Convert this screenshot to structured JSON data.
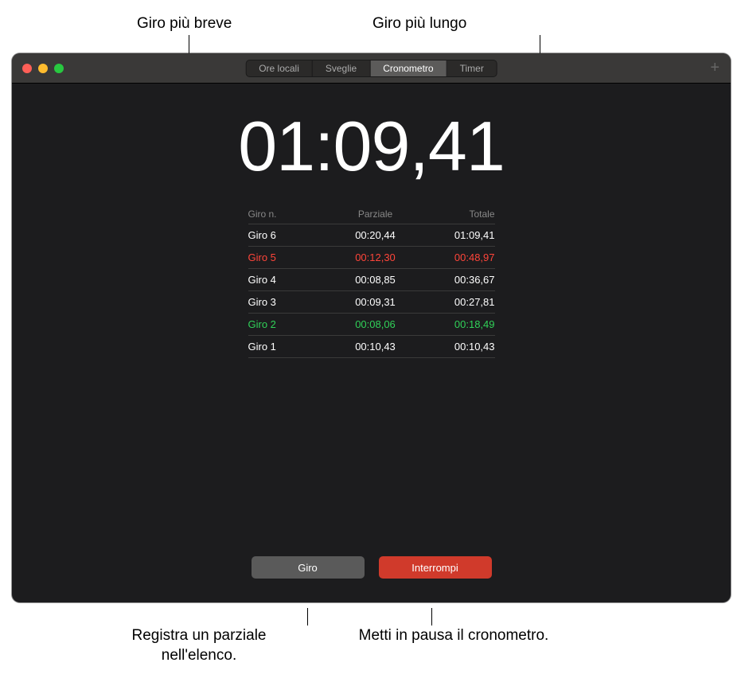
{
  "callouts": {
    "shortest": "Giro più breve",
    "longest": "Giro più lungo",
    "lap_desc": "Registra un parziale nell'elenco.",
    "stop_desc": "Metti in pausa il cronometro."
  },
  "tabs": {
    "world": "Ore locali",
    "alarms": "Sveglie",
    "stopwatch": "Cronometro",
    "timer": "Timer"
  },
  "time": "01:09,41",
  "headers": {
    "lap": "Giro n.",
    "split": "Parziale",
    "total": "Totale"
  },
  "laps": [
    {
      "name": "Giro 6",
      "split": "00:20,44",
      "total": "01:09,41",
      "cls": ""
    },
    {
      "name": "Giro 5",
      "split": "00:12,30",
      "total": "00:48,97",
      "cls": "slowest"
    },
    {
      "name": "Giro 4",
      "split": "00:08,85",
      "total": "00:36,67",
      "cls": ""
    },
    {
      "name": "Giro 3",
      "split": "00:09,31",
      "total": "00:27,81",
      "cls": ""
    },
    {
      "name": "Giro 2",
      "split": "00:08,06",
      "total": "00:18,49",
      "cls": "fastest"
    },
    {
      "name": "Giro 1",
      "split": "00:10,43",
      "total": "00:10,43",
      "cls": ""
    }
  ],
  "buttons": {
    "lap": "Giro",
    "stop": "Interrompi"
  },
  "plus": "+"
}
